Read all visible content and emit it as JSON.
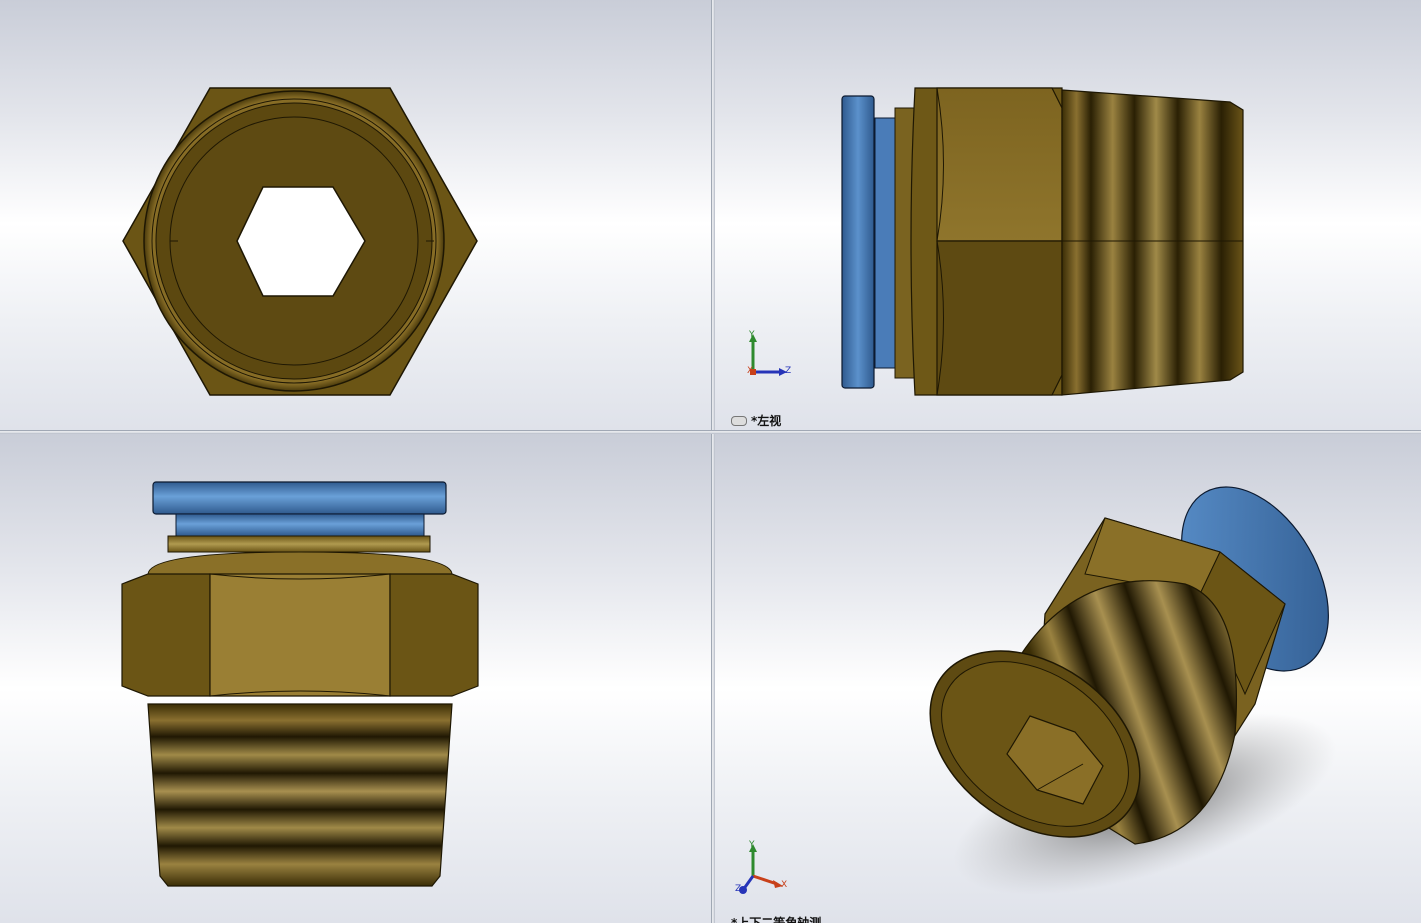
{
  "viewports": {
    "top_left": {
      "name": "front-view"
    },
    "top_right": {
      "name": "left-view",
      "label": "*左视"
    },
    "bottom_left": {
      "name": "top-view"
    },
    "bottom_right": {
      "name": "isometric-view",
      "label": "*上下二等角轴测"
    }
  },
  "triad": {
    "x": "X",
    "y": "Y",
    "z": "Z"
  },
  "colors": {
    "brass_dark": "#5e4a12",
    "brass_mid": "#8a6f27",
    "brass_light": "#a68c3a",
    "blue_ring": "#3c6ea8",
    "blue_light": "#5b91cc",
    "axis_x": "#c8401a",
    "axis_y": "#2e8a2e",
    "axis_z": "#2634b8"
  }
}
